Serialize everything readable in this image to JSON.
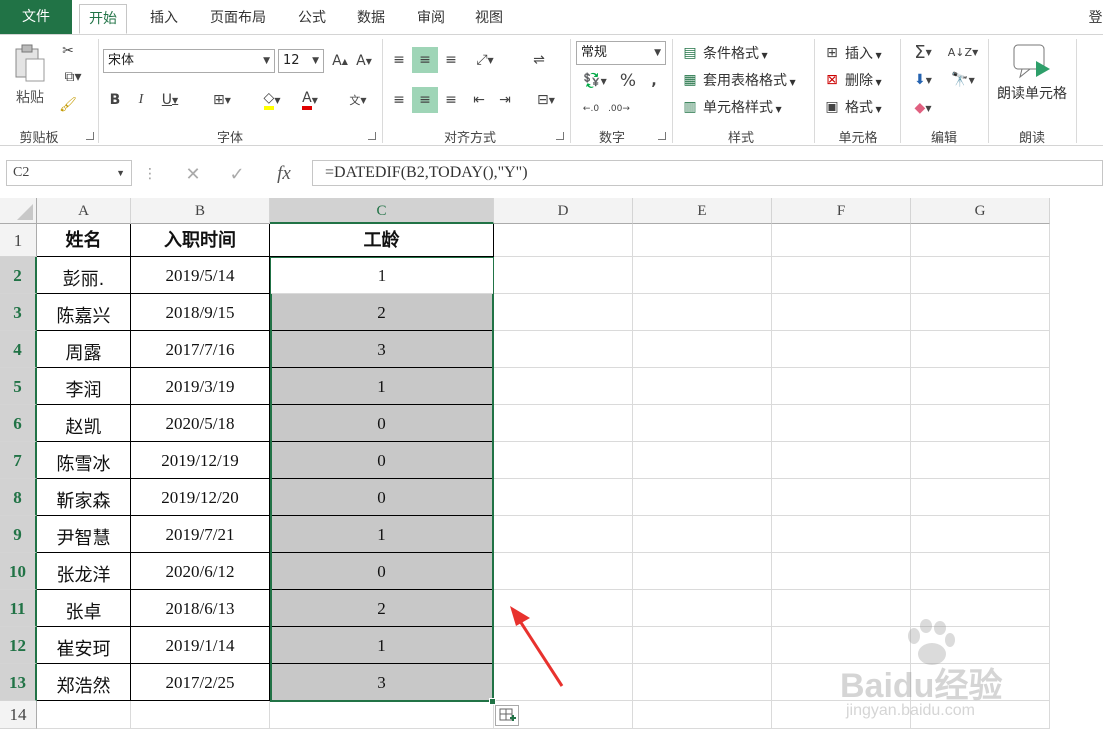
{
  "tabs": [
    "文件",
    "开始",
    "插入",
    "页面布局",
    "公式",
    "数据",
    "审阅",
    "视图"
  ],
  "tab_right": "登",
  "ribbon": {
    "paste_label": "粘贴",
    "font_name": "宋体",
    "font_size": "12",
    "number_format": "常规",
    "conditional_format": "条件格式",
    "table_format": "套用表格格式",
    "cell_style": "单元格样式",
    "insert": "插入",
    "delete": "删除",
    "format": "格式",
    "read_cells": "朗读单元格",
    "groups": {
      "clipboard": "剪贴板",
      "font": "字体",
      "alignment": "对齐方式",
      "number": "数字",
      "styles": "样式",
      "cells": "单元格",
      "editing": "编辑",
      "read": "朗读"
    }
  },
  "formula_bar": {
    "name_box": "C2",
    "formula": "=DATEDIF(B2,TODAY(),\"Y\")"
  },
  "sheet": {
    "columns": [
      "A",
      "B",
      "C",
      "D",
      "E",
      "F",
      "G"
    ],
    "rows": [
      "1",
      "2",
      "3",
      "4",
      "5",
      "6",
      "7",
      "8",
      "9",
      "10",
      "11",
      "12",
      "13",
      "14"
    ],
    "headers": [
      "姓名",
      "入职时间",
      "工龄"
    ],
    "data": [
      [
        "彭丽.",
        "2019/5/14",
        "1"
      ],
      [
        "陈嘉兴",
        "2018/9/15",
        "2"
      ],
      [
        "周露",
        "2017/7/16",
        "3"
      ],
      [
        "李润",
        "2019/3/19",
        "1"
      ],
      [
        "赵凯",
        "2020/5/18",
        "0"
      ],
      [
        "陈雪冰",
        "2019/12/19",
        "0"
      ],
      [
        "靳家森",
        "2019/12/20",
        "0"
      ],
      [
        "尹智慧",
        "2019/7/21",
        "1"
      ],
      [
        "张龙洋",
        "2020/6/12",
        "0"
      ],
      [
        "张卓",
        "2018/6/13",
        "2"
      ],
      [
        "崔安珂",
        "2019/1/14",
        "1"
      ],
      [
        "郑浩然",
        "2017/2/25",
        "3"
      ]
    ]
  },
  "watermark": {
    "brand": "Baidu经验",
    "url": "jingyan.baidu.com"
  },
  "colors": {
    "excel_green": "#217346",
    "selection_fill": "#c8c8c8",
    "arrow": "#e8322e"
  }
}
